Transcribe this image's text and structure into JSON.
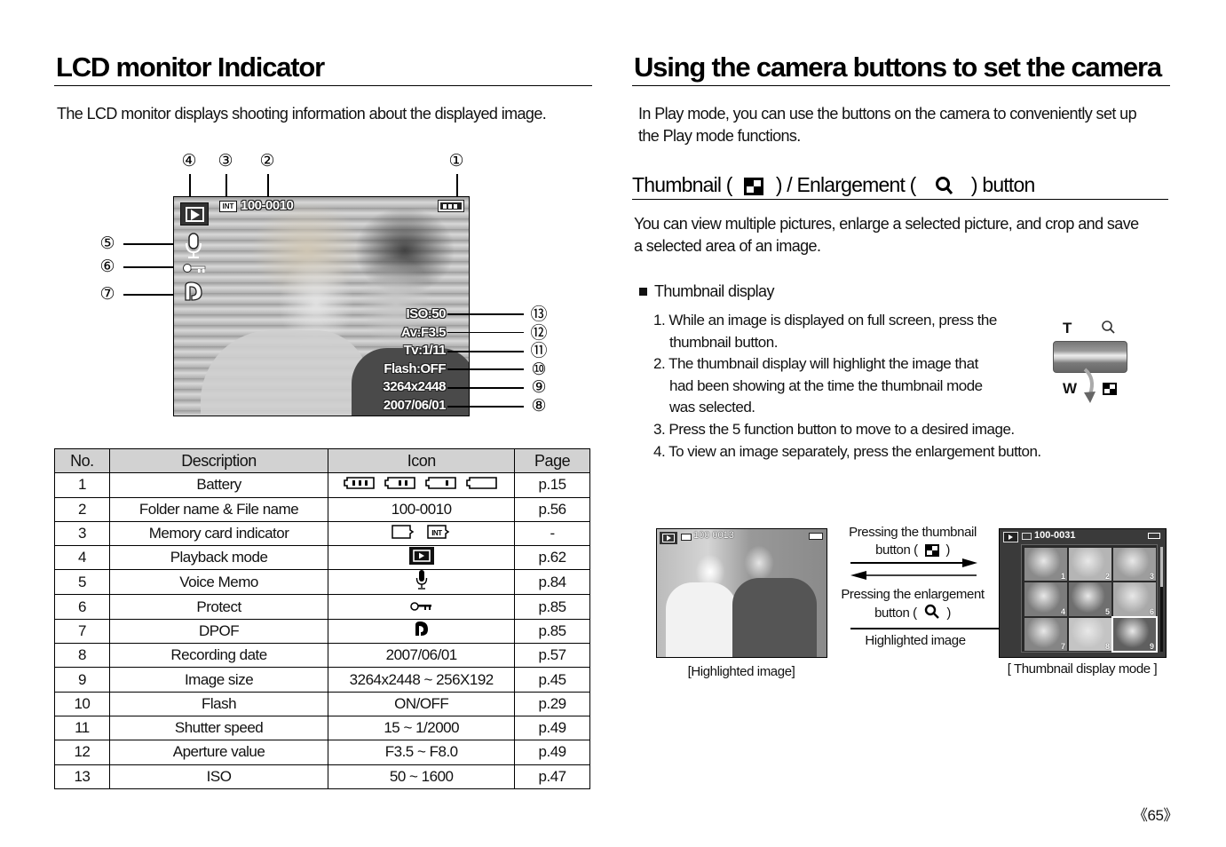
{
  "left": {
    "title": "LCD monitor Indicator",
    "intro": "The LCD monitor displays shooting information about the displayed image.",
    "callouts_top": [
      "④",
      "③",
      "②",
      "①"
    ],
    "callouts_left": [
      "⑤",
      "⑥",
      "⑦"
    ],
    "callouts_right": [
      "⑬",
      "⑫",
      "⑪",
      "⑩",
      "⑨",
      "⑧"
    ],
    "lcd": {
      "file_name": "100-0010",
      "card_label": "INT",
      "iso": "ISO:50",
      "aperture": "Av:F3.5",
      "shutter": "Tv:1/11",
      "flash": "Flash:OFF",
      "size": "3264x2448",
      "date": "2007/06/01"
    },
    "table": {
      "headers": [
        "No.",
        "Description",
        "Icon",
        "Page"
      ],
      "rows": [
        {
          "no": "1",
          "desc": "Battery",
          "icon": "battery-levels-icon",
          "icon_text": "",
          "page": "p.15"
        },
        {
          "no": "2",
          "desc": "Folder name & File name",
          "icon": "",
          "icon_text": "100-0010",
          "page": "p.56"
        },
        {
          "no": "3",
          "desc": "Memory card indicator",
          "icon": "memory-card-icons",
          "icon_text": "INT",
          "page": "-"
        },
        {
          "no": "4",
          "desc": "Playback mode",
          "icon": "playback-mode-icon",
          "icon_text": "",
          "page": "p.62"
        },
        {
          "no": "5",
          "desc": "Voice Memo",
          "icon": "microphone-icon",
          "icon_text": "",
          "page": "p.84"
        },
        {
          "no": "6",
          "desc": "Protect",
          "icon": "key-icon",
          "icon_text": "",
          "page": "p.85"
        },
        {
          "no": "7",
          "desc": "DPOF",
          "icon": "dpof-icon",
          "icon_text": "",
          "page": "p.85"
        },
        {
          "no": "8",
          "desc": "Recording date",
          "icon": "",
          "icon_text": "2007/06/01",
          "page": "p.57"
        },
        {
          "no": "9",
          "desc": "Image size",
          "icon": "",
          "icon_text": "3264x2448 ~ 256X192",
          "page": "p.45"
        },
        {
          "no": "10",
          "desc": "Flash",
          "icon": "",
          "icon_text": "ON/OFF",
          "page": "p.29"
        },
        {
          "no": "11",
          "desc": "Shutter speed",
          "icon": "",
          "icon_text": "15 ~ 1/2000",
          "page": "p.49"
        },
        {
          "no": "12",
          "desc": "Aperture value",
          "icon": "",
          "icon_text": "F3.5 ~ F8.0",
          "page": "p.49"
        },
        {
          "no": "13",
          "desc": "ISO",
          "icon": "",
          "icon_text": "50 ~ 1600",
          "page": "p.47"
        }
      ]
    }
  },
  "right": {
    "title": "Using the camera buttons to set the camera",
    "intro_line1": "In Play mode, you can use the buttons on the camera to conveniently set up",
    "intro_line2": "the Play mode functions.",
    "section": {
      "prefix": "Thumbnail (",
      "middle": ") / Enlargement (",
      "suffix": ") button"
    },
    "desc_line1": "You can view multiple pictures, enlarge a selected picture, and crop and save",
    "desc_line2": "a selected area of an image.",
    "bullet": "Thumbnail display",
    "steps": [
      "1. While an image is displayed on full screen, press the",
      "thumbnail  button.",
      "2. The thumbnail display will highlight the image that",
      "had been showing at the time the thumbnail mode",
      "was selected.",
      "3. Press the 5 function button to move to a desired image.",
      "4. To view an image separately, press the enlargement button."
    ],
    "zoom_lever": {
      "t_label": "T",
      "w_label": "W"
    },
    "diagram": {
      "left_lcd_file": "100 0013",
      "right_lcd_file": "100-0031",
      "press_thumb_1": "Pressing the thumbnail",
      "press_thumb_2a": "button (",
      "press_thumb_2b": ")",
      "press_enlarge_1": "Pressing the enlargement",
      "press_enlarge_2a": "button (",
      "press_enlarge_2b": ")",
      "highlighted": "Highlighted image",
      "caption_left": "[Highlighted image]",
      "caption_right": "[ Thumbnail display mode ]",
      "thumb_numbers": [
        "1",
        "2",
        "3",
        "4",
        "5",
        "6",
        "7",
        "8",
        "9"
      ]
    }
  },
  "page_number": "《65》"
}
